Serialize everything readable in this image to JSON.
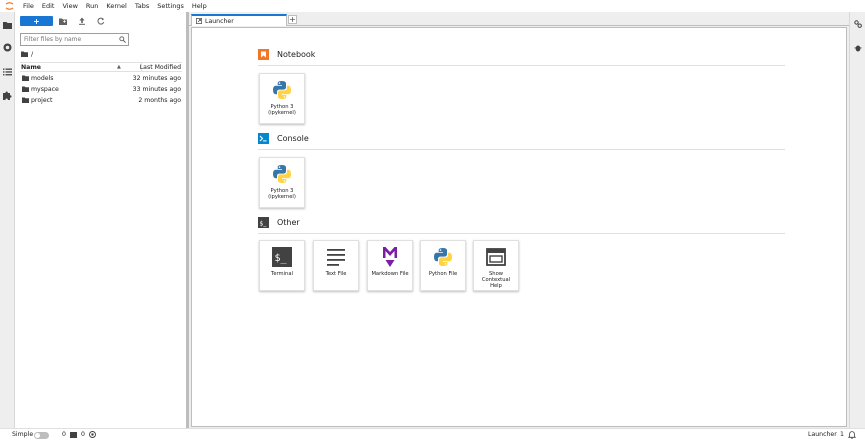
{
  "menu": {
    "items": [
      "File",
      "Edit",
      "View",
      "Run",
      "Kernel",
      "Tabs",
      "Settings",
      "Help"
    ]
  },
  "filebrowser": {
    "new_label": "+",
    "filter_placeholder": "Filter files by name",
    "breadcrumb": "/",
    "header": {
      "name": "Name",
      "modified": "Last Modified"
    },
    "files": [
      {
        "name": "models",
        "modified": "32 minutes ago"
      },
      {
        "name": "myspace",
        "modified": "33 minutes ago"
      },
      {
        "name": "project",
        "modified": "2 months ago"
      }
    ]
  },
  "tabs": [
    {
      "label": "Launcher"
    }
  ],
  "launcher": {
    "sections": [
      {
        "title": "Notebook",
        "cards": [
          {
            "label_line1": "Python 3",
            "label_line2": "(ipykernel)"
          }
        ]
      },
      {
        "title": "Console",
        "cards": [
          {
            "label_line1": "Python 3",
            "label_line2": "(ipykernel)"
          }
        ]
      },
      {
        "title": "Other",
        "cards": [
          {
            "label": "Terminal"
          },
          {
            "label": "Text File"
          },
          {
            "label": "Markdown File"
          },
          {
            "label": "Python File"
          },
          {
            "label_line1": "Show",
            "label_line2": "Contextual",
            "label_line3": "Help"
          }
        ]
      }
    ]
  },
  "statusbar": {
    "mode": "Simple",
    "terminals": "0",
    "kernels": "0",
    "active": "Launcher",
    "count": "1"
  },
  "colors": {
    "accent": "#1976d2",
    "notebook_icon": "#f37626",
    "console_icon": "#0288d1",
    "markdown_icon": "#7b1fa2"
  }
}
